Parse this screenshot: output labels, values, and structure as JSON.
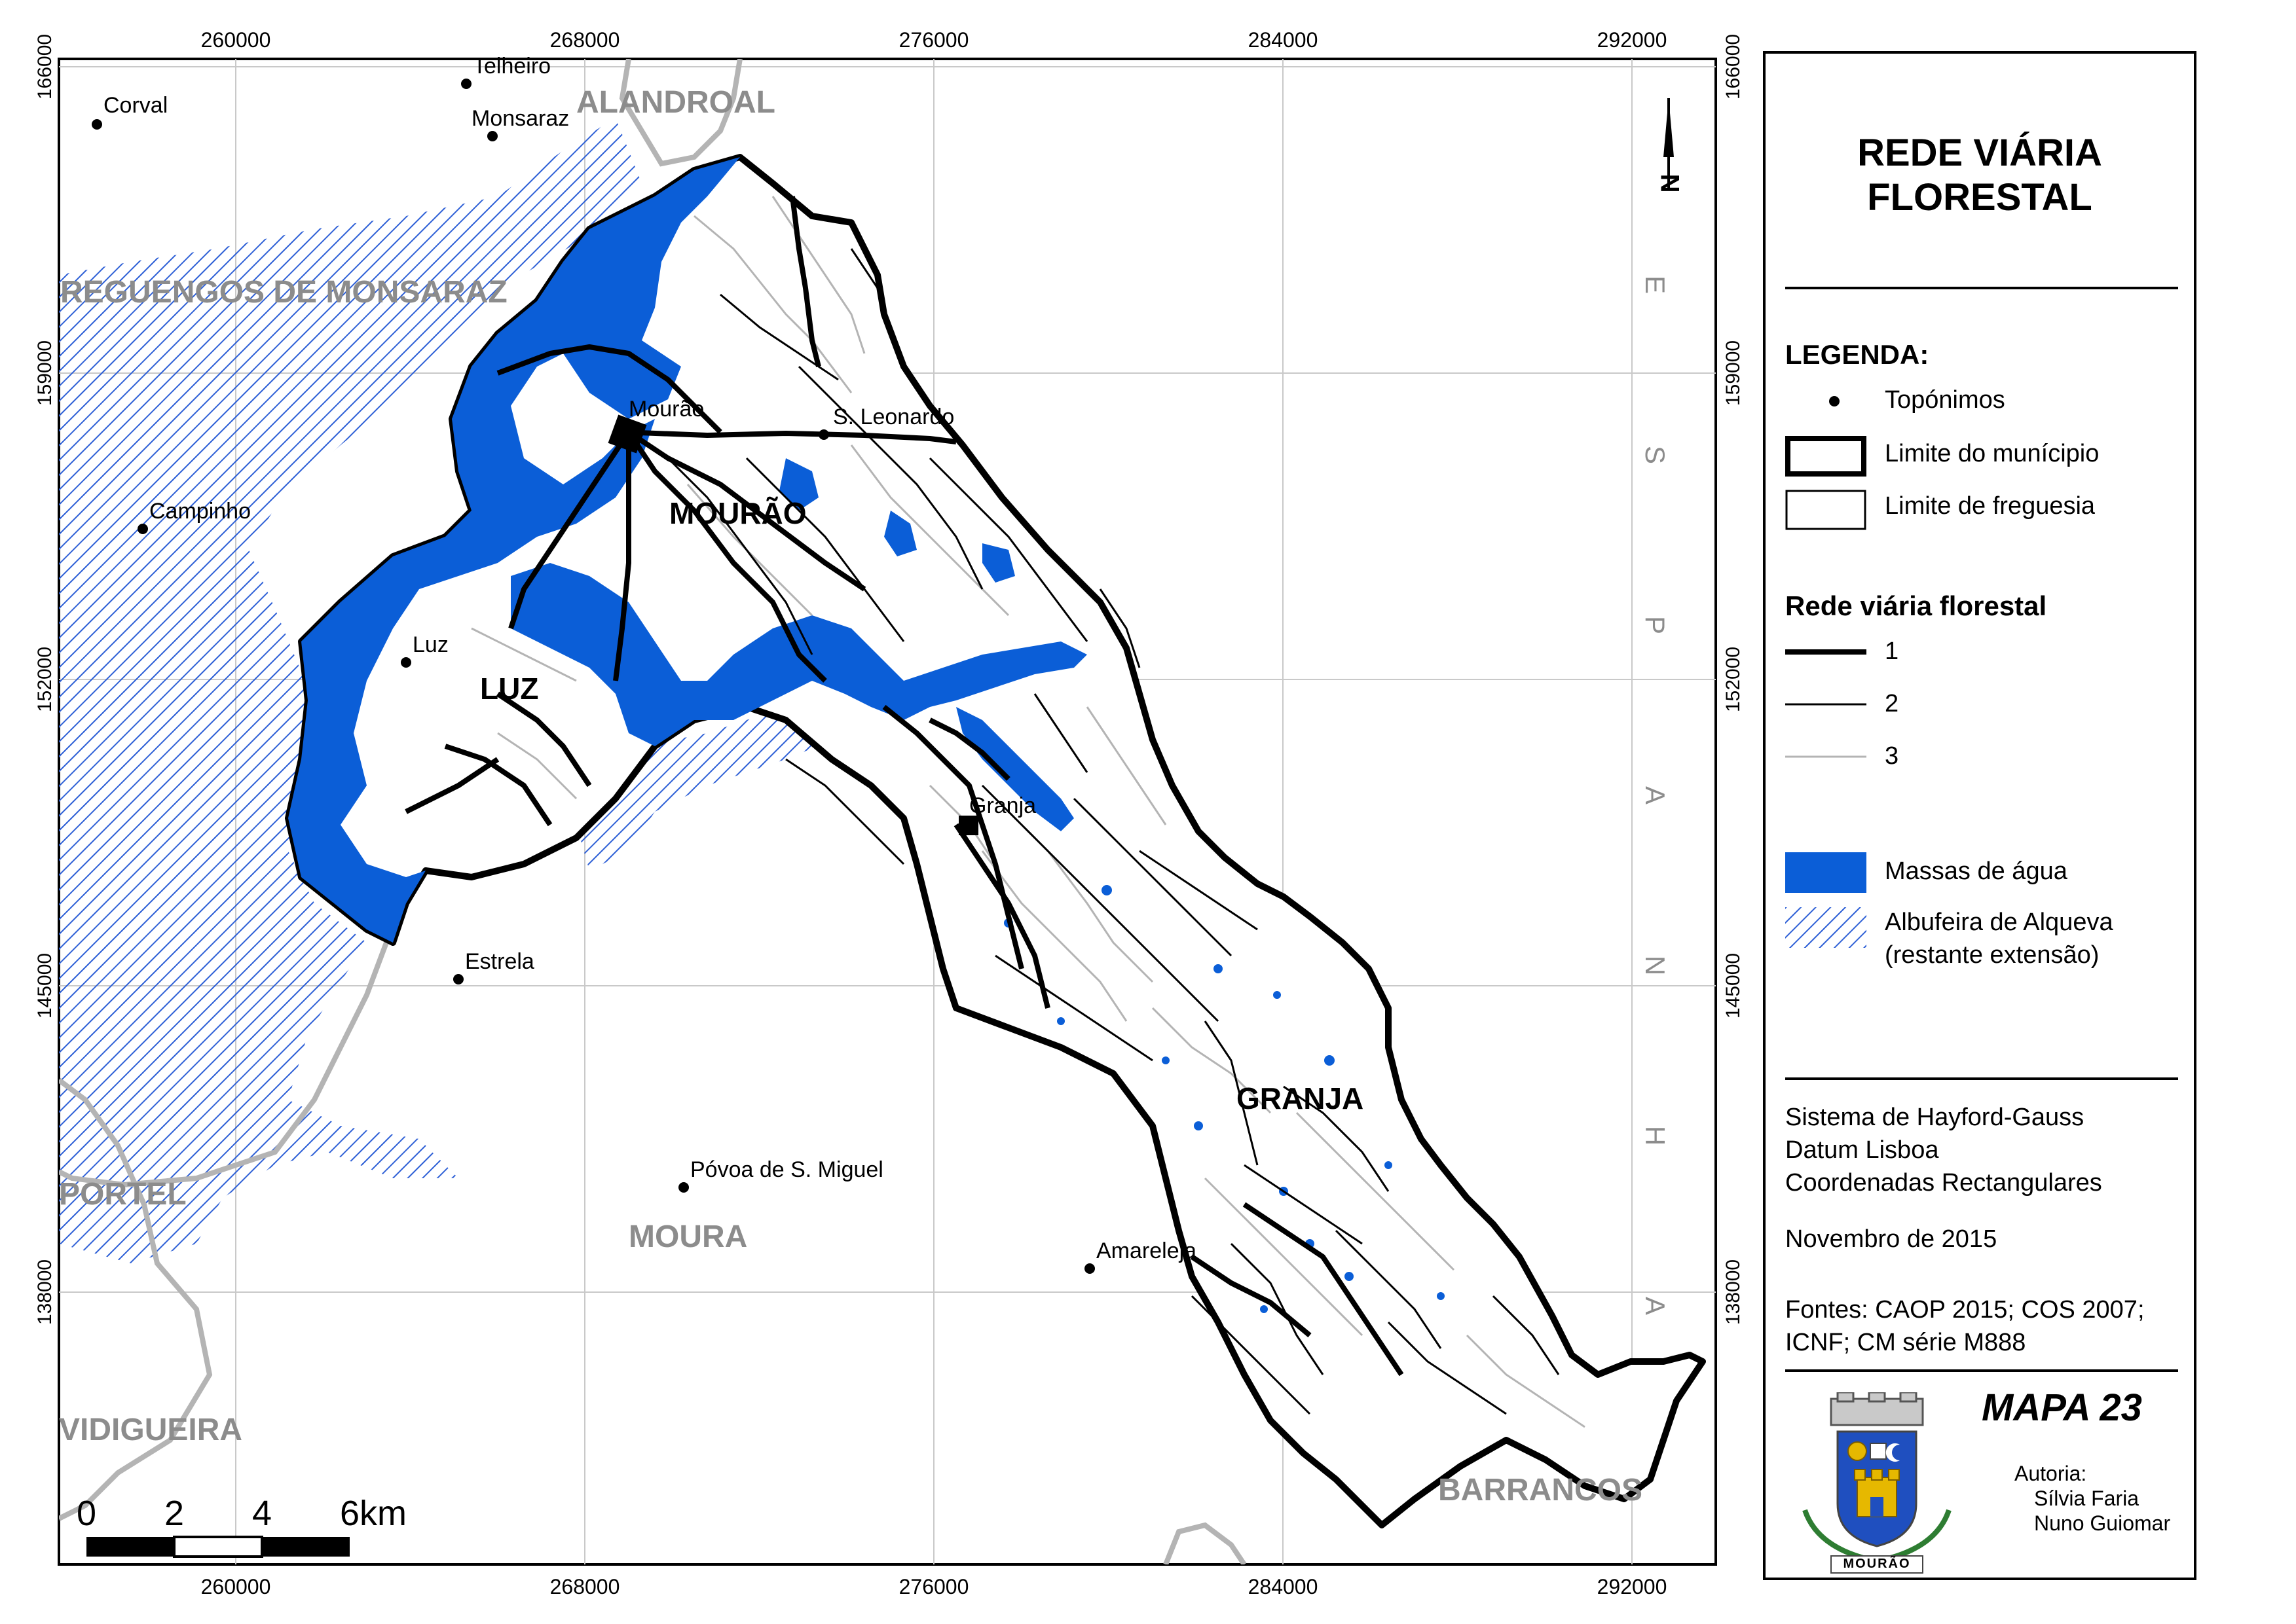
{
  "map": {
    "x_ticks": [
      "260000",
      "268000",
      "276000",
      "284000",
      "292000"
    ],
    "y_ticks": [
      "166000",
      "159000",
      "152000",
      "145000",
      "138000"
    ],
    "places": [
      {
        "name": "Corval"
      },
      {
        "name": "Telheiro"
      },
      {
        "name": "Monsaraz"
      },
      {
        "name": "Mourão"
      },
      {
        "name": "S. Leonardo"
      },
      {
        "name": "Campinho"
      },
      {
        "name": "Luz"
      },
      {
        "name": "Granja"
      },
      {
        "name": "Estrela"
      },
      {
        "name": "Póvoa de S. Miguel"
      },
      {
        "name": "Amareleja"
      }
    ],
    "municipalities": [
      "ALANDROAL",
      "REGUENGOS DE MONSARAZ",
      "PORTEL",
      "MOURA",
      "VIDIGUEIRA",
      "BARRANCOS"
    ],
    "parishes": [
      "MOURÃO",
      "LUZ",
      "GRANJA"
    ],
    "spain_letters": [
      "E",
      "S",
      "P",
      "A",
      "N",
      "H",
      "A"
    ],
    "scale_labels": [
      "0",
      "2",
      "4",
      "6km"
    ],
    "north_symbol": "N",
    "colors": {
      "water": "#0b5ed7",
      "hatch": "#2d5fd6",
      "neighbour_label": "#8c8c8c",
      "grey_road": "#b4b4b4"
    }
  },
  "legend": {
    "title_line1": "REDE VIÁRIA",
    "title_line2": "FLORESTAL",
    "legend_heading": "LEGENDA:",
    "toponyms": "Topónimos",
    "municipality_limit": "Limite do munícipio",
    "parish_limit": "Limite de freguesia",
    "road_heading": "Rede viária florestal",
    "road_class_1": "1",
    "road_class_2": "2",
    "road_class_3": "3",
    "water": "Massas de água",
    "reservoir_line1": "Albufeira de Alqueva",
    "reservoir_line2": "(restante extensão)",
    "crs_line1": "Sistema de Hayford-Gauss",
    "crs_line2": "Datum Lisboa",
    "crs_line3": "Coordenadas Rectangulares",
    "date": "Novembro de 2015",
    "sources_line1": "Fontes: CAOP 2015; COS 2007;",
    "sources_line2": "ICNF; CM série M888",
    "map_number": "MAPA 23",
    "authorship_label": "Autoria:",
    "author1": "Sílvia Faria",
    "author2": "Nuno Guiomar",
    "crest_caption": "MOURÃO"
  }
}
